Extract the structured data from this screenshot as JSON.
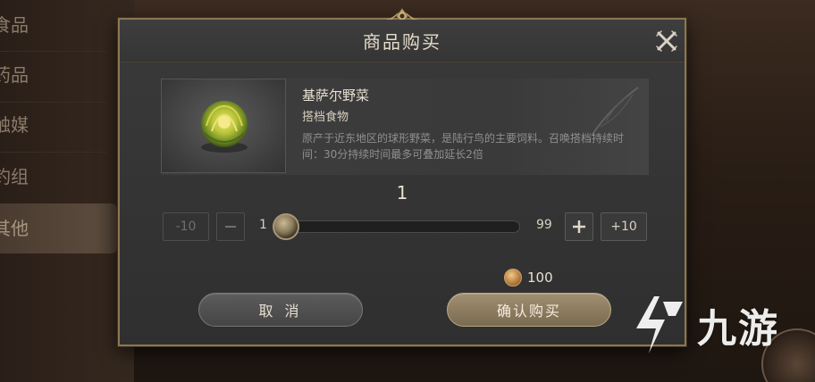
{
  "background": {
    "categories": [
      "食品",
      "药品",
      "触媒",
      "钓组",
      "其他"
    ],
    "active_index": 4
  },
  "dialog": {
    "title": "商品购买",
    "close_icon": "close-icon"
  },
  "item": {
    "name": "基萨尔野菜",
    "type": "搭档食物",
    "description": "原产于近东地区的球形野菜，是陆行鸟的主要饲料。召唤搭档持续时间：30分持续时间最多可叠加延长2倍",
    "icon": "cabbage-icon"
  },
  "quantity": {
    "value": "1",
    "min": "1",
    "max": "99",
    "minus10_label": "-10",
    "minus_label": "—",
    "plus_label": "+",
    "plus10_label": "+10",
    "fraction": 0.0
  },
  "price": {
    "amount": "100",
    "currency_icon": "coin-icon"
  },
  "buttons": {
    "cancel": "取 消",
    "confirm": "确认购买"
  },
  "watermark": {
    "text": "九游"
  },
  "colors": {
    "gold_border": "#8c7752",
    "confirm_button": "#8f7f61",
    "cancel_button": "#505050"
  }
}
